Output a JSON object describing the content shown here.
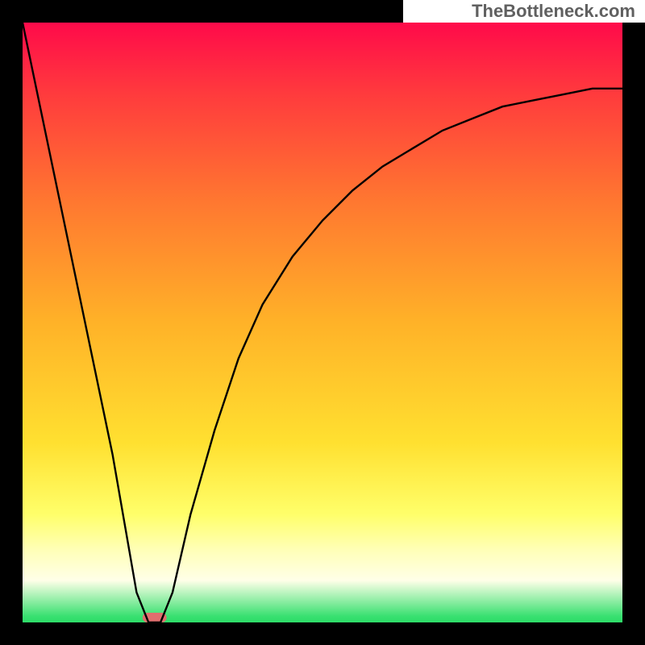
{
  "watermark": "TheBottleneck.com",
  "chart_data": {
    "type": "line",
    "title": "",
    "xlabel": "",
    "ylabel": "",
    "xlim": [
      0,
      1
    ],
    "ylim": [
      0,
      1
    ],
    "grid": false,
    "series": [
      {
        "name": "bottleneck-curve",
        "x": [
          0.0,
          0.05,
          0.1,
          0.15,
          0.19,
          0.21,
          0.23,
          0.25,
          0.28,
          0.32,
          0.36,
          0.4,
          0.45,
          0.5,
          0.55,
          0.6,
          0.65,
          0.7,
          0.75,
          0.8,
          0.85,
          0.9,
          0.95,
          1.0
        ],
        "y": [
          1.0,
          0.76,
          0.52,
          0.28,
          0.05,
          0.0,
          0.0,
          0.05,
          0.18,
          0.32,
          0.44,
          0.53,
          0.61,
          0.67,
          0.72,
          0.76,
          0.79,
          0.82,
          0.84,
          0.86,
          0.87,
          0.88,
          0.89,
          0.89
        ]
      }
    ],
    "marker": {
      "x": 0.22,
      "width": 0.04,
      "color": "#e06e6e"
    },
    "gradient_stops": [
      {
        "pos": 0.0,
        "color": "#ff0a4a"
      },
      {
        "pos": 0.12,
        "color": "#ff3b3d"
      },
      {
        "pos": 0.3,
        "color": "#ff7830"
      },
      {
        "pos": 0.5,
        "color": "#ffb228"
      },
      {
        "pos": 0.7,
        "color": "#ffe030"
      },
      {
        "pos": 0.82,
        "color": "#ffff6a"
      },
      {
        "pos": 0.88,
        "color": "#ffffb8"
      },
      {
        "pos": 0.93,
        "color": "#ffffe8"
      },
      {
        "pos": 0.99,
        "color": "#38e070"
      },
      {
        "pos": 1.0,
        "color": "#2edc68"
      }
    ]
  }
}
